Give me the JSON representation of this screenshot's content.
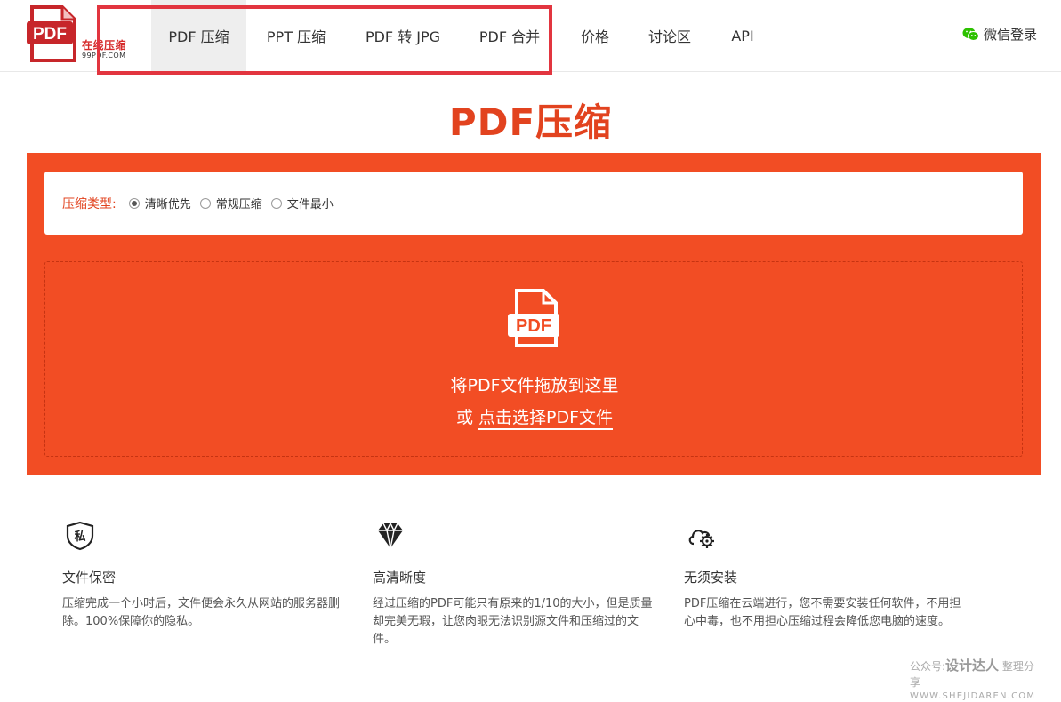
{
  "header": {
    "logo": {
      "mark_text": "PDF",
      "subtitle": "在线压缩",
      "domain": "99PDF.COM"
    },
    "nav": [
      {
        "label": "PDF 压缩",
        "active": true
      },
      {
        "label": "PPT 压缩",
        "active": false
      },
      {
        "label": "PDF 转 JPG",
        "active": false
      },
      {
        "label": "PDF 合并",
        "active": false
      },
      {
        "label": "价格",
        "active": false
      },
      {
        "label": "讨论区",
        "active": false
      },
      {
        "label": "API",
        "active": false
      }
    ],
    "login_label": "微信登录",
    "login_icon": "wechat-icon"
  },
  "main": {
    "title": "PDF压缩",
    "compression": {
      "label": "压缩类型:",
      "options": [
        "清晰优先",
        "常规压缩",
        "文件最小"
      ],
      "selected": "清晰优先"
    },
    "dropzone": {
      "icon": "pdf-file-icon",
      "icon_text": "PDF",
      "text": "将PDF文件拖放到这里",
      "or_text": "或",
      "link_text": "点击选择PDF文件"
    }
  },
  "features": [
    {
      "icon": "privacy-shield-icon",
      "icon_text": "私",
      "title": "文件保密",
      "desc": "压缩完成一个小时后，文件便会永久从网站的服务器删除。100%保障你的隐私。"
    },
    {
      "icon": "diamond-icon",
      "title": "高清晰度",
      "desc": "经过压缩的PDF可能只有原来的1/10的大小，但是质量却完美无瑕，让您肉眼无法识别源文件和压缩过的文件。"
    },
    {
      "icon": "cloud-gear-icon",
      "title": "无须安装",
      "desc": "PDF压缩在云端进行，您不需要安装任何软件，不用担心中毒，也不用担心压缩过程会降低您电脑的速度。"
    }
  ],
  "watermark": {
    "prefix": "公众号:",
    "brand": "设计达人",
    "suffix": "整理分享",
    "url": "WWW.SHEJIDAREN.COM"
  },
  "colors": {
    "accent": "#f24d24",
    "title": "#e2431f",
    "highlight_box": "#e2353f",
    "wechat": "#2dc100"
  }
}
